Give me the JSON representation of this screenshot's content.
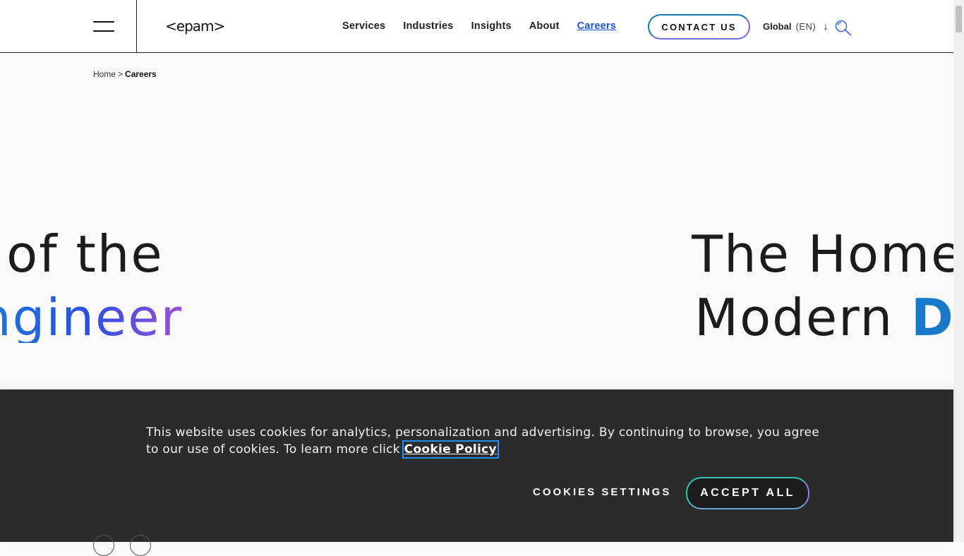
{
  "header": {
    "logo_text": "<epam>",
    "nav": [
      {
        "label": "Services"
      },
      {
        "label": "Industries"
      },
      {
        "label": "Insights"
      },
      {
        "label": "About"
      },
      {
        "label": "Careers",
        "active": true
      }
    ],
    "contact_label": "CONTACT US",
    "lang_region": "Global",
    "lang_code": "(EN)"
  },
  "breadcrumb": {
    "home": "Home",
    "separator": ">",
    "current": "Careers"
  },
  "hero": {
    "left_line1": "e of the",
    "left_line2": "ngineer",
    "right_line1": "The Home",
    "right_line2_start": "Modern ",
    "right_line2_accent": "D"
  },
  "cookie": {
    "text": "This website uses cookies for analytics, personalization and advertising. By continuing to browse, you agree to our use of cookies. To learn more click ",
    "link_label": "Cookie Policy",
    "settings_label": "COOKIES SETTINGS",
    "accept_label": "ACCEPT ALL"
  },
  "icons": {
    "menu": "hamburger-icon",
    "lang_arrow": "arrow-down-icon",
    "search": "search-icon"
  },
  "colors": {
    "accent_blue": "#1a55d4",
    "gradient_start": "#1a7ad8",
    "gradient_end": "#9b4fd6",
    "cookie_bg": "#2b2b2b"
  }
}
